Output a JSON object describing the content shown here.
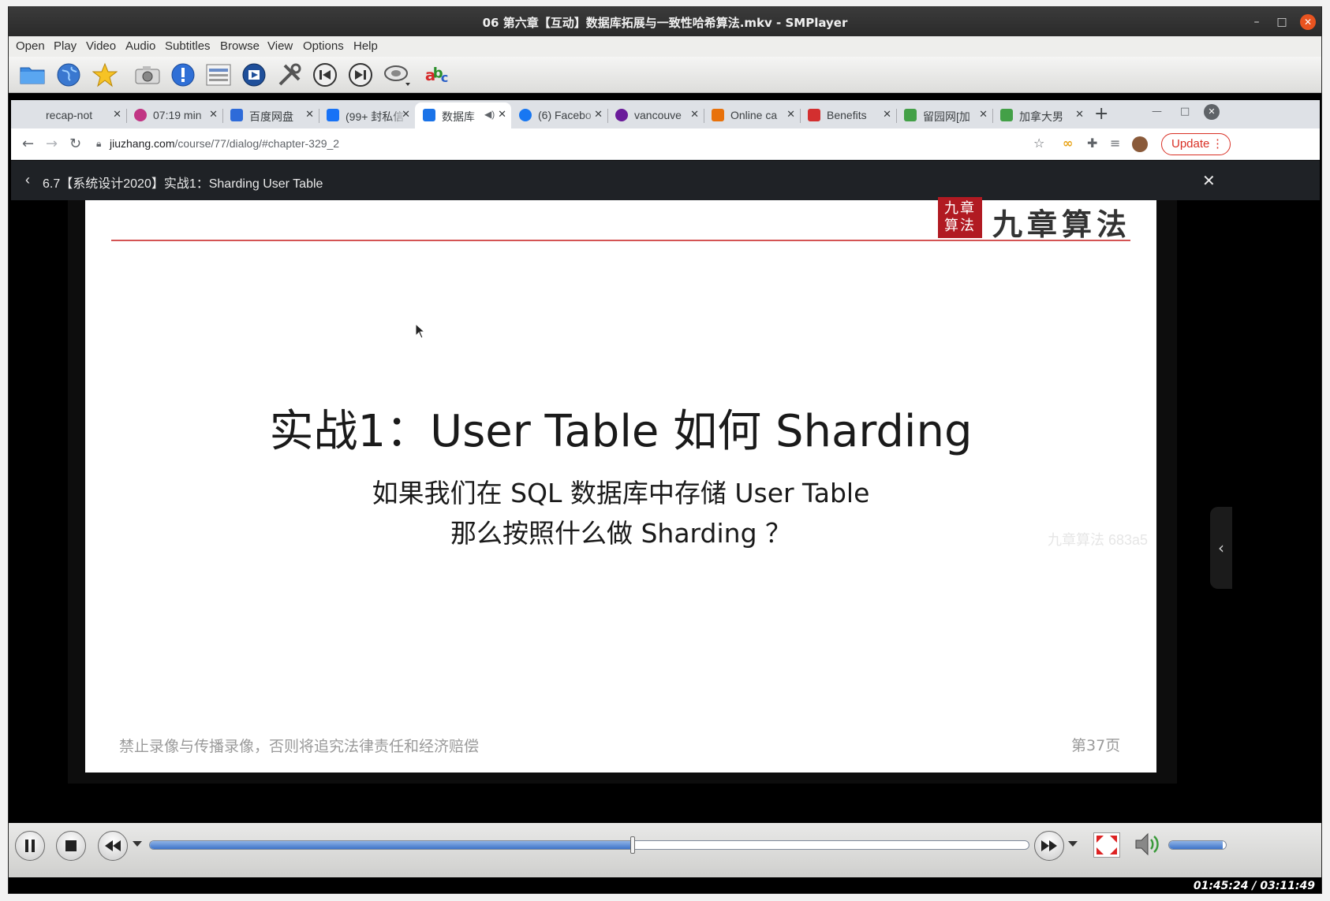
{
  "window": {
    "title": "06 第六章【互动】数据库拓展与一致性哈希算法.mkv - SMPlayer",
    "minimize_glyph": "–",
    "maximize_glyph": "□",
    "close_glyph": "✕"
  },
  "menu": {
    "items": [
      "Open",
      "Play",
      "Video",
      "Audio",
      "Subtitles",
      "Browse",
      "View",
      "Options",
      "Help"
    ]
  },
  "toolbar": {
    "icons": [
      "open-folder-icon",
      "globe-icon",
      "favorite-star-icon",
      "screenshot-camera-icon",
      "info-icon",
      "playlist-icon",
      "preferences-film-icon",
      "tools-icon",
      "previous-icon",
      "next-icon",
      "audio-track-icon",
      "subtitles-icon"
    ]
  },
  "browser": {
    "tabs": [
      {
        "label": "recap-not",
        "color": "#dee1e6"
      },
      {
        "label": "07:19 min",
        "color": "#c13584"
      },
      {
        "label": "百度网盘",
        "color": "#2e6bd9"
      },
      {
        "label": "(99+ 封私信",
        "color": "#1772f6"
      },
      {
        "label": "数据库",
        "color": "#1a73e8"
      },
      {
        "label": "(6) Facebo",
        "color": "#1877f2"
      },
      {
        "label": "vancouve",
        "color": "#6a1b9a"
      },
      {
        "label": "Online ca",
        "color": "#e8710a"
      },
      {
        "label": "Benefits",
        "color": "#d32f2f"
      },
      {
        "label": "留园网[加",
        "color": "#43a047"
      },
      {
        "label": "加拿大男",
        "color": "#43a047"
      }
    ],
    "active_tab_index": 4,
    "new_tab_glyph": "+",
    "url": "jiuzhang.com/course/77/dialog/#chapter-329_2",
    "url_host": "jiuzhang.com",
    "url_path": "/course/77/dialog/#chapter-329_2",
    "update_label": "Update",
    "page_header_title": "6.7【系统设计2020】实战1：Sharding User Table"
  },
  "slide": {
    "brand_seal": "九章算法",
    "brand_text": "九章算法",
    "headline": "实战1：User Table 如何 Sharding",
    "subline1": "如果我们在 SQL 数据库中存储 User Table",
    "subline2": "那么按照什么做 Sharding ？",
    "footer_notice": "禁止录像与传播录像，否则将追究法律责任和经济赔偿",
    "page_number": "第37页",
    "watermark": "九章算法 683a5"
  },
  "player": {
    "elapsed": "01:45:24",
    "total": "03:11:49",
    "time_display": "01:45:24 / 03:11:49",
    "progress_fraction": 0.549,
    "volume_fraction": 0.95,
    "accent_color": "#3e74c9"
  }
}
